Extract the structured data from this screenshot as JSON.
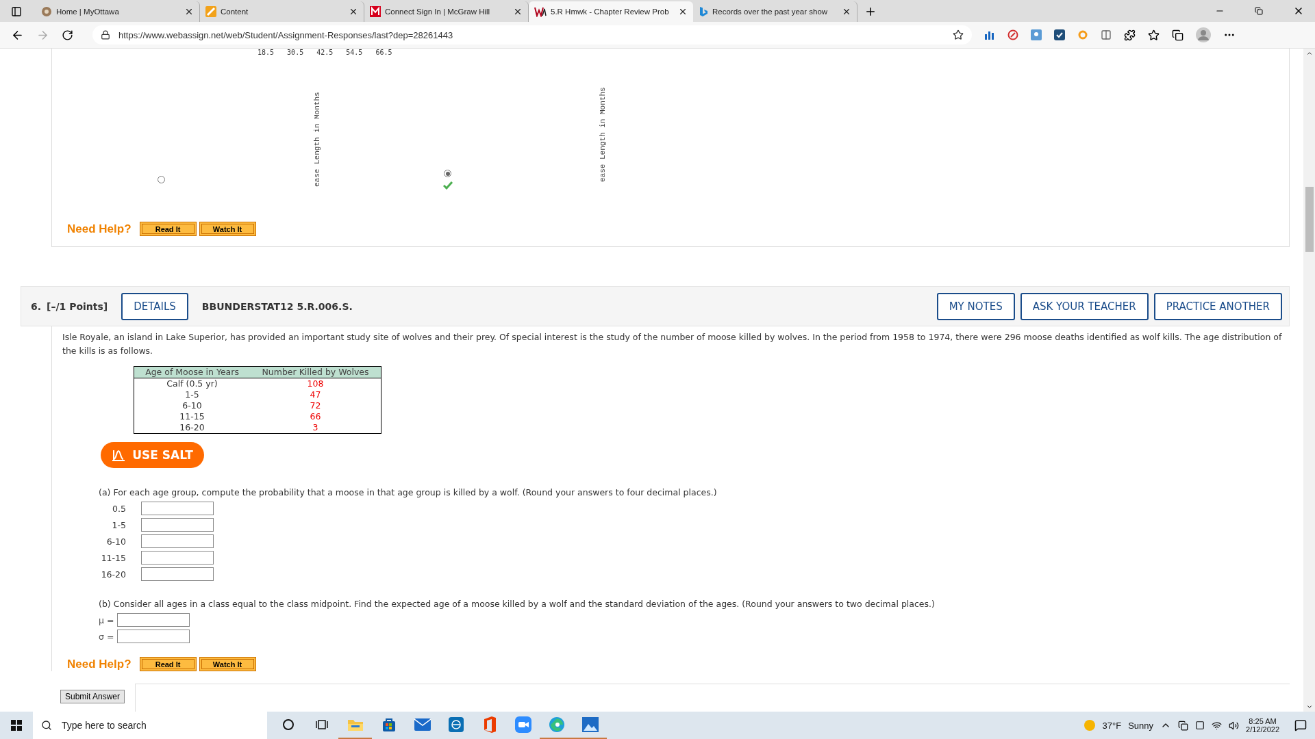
{
  "browser": {
    "tabs": [
      {
        "title": "Home | MyOttawa",
        "kind": "ottawa",
        "selected": false
      },
      {
        "title": "Content",
        "kind": "content",
        "selected": false
      },
      {
        "title": "Connect Sign In | McGraw Hill",
        "kind": "mcgraw",
        "selected": false
      },
      {
        "title": "5.R Hmwk - Chapter Review Prob",
        "kind": "webassign",
        "selected": true
      },
      {
        "title": "Records over the past year show",
        "kind": "bing",
        "selected": false
      }
    ],
    "address": "https://www.webassign.net/web/Student/Assignment-Responses/last?dep=28261443"
  },
  "previous_question": {
    "x_ticks": [
      "18.5",
      "30.5",
      "42.5",
      "54.5",
      "66.5"
    ],
    "axis_labels": [
      "ease Length in Months",
      "ease Length in Months"
    ],
    "options": [
      {
        "selected": false,
        "correct": false
      },
      {
        "selected": true,
        "correct": true
      }
    ],
    "help_label": "Need Help?",
    "help_buttons": [
      "Read It",
      "Watch It"
    ]
  },
  "question": {
    "number": "6.",
    "points": "[–/1 Points]",
    "details": "DETAILS",
    "code": "BBUNDERSTAT12 5.R.006.S.",
    "actions": [
      "MY NOTES",
      "ASK YOUR TEACHER",
      "PRACTICE ANOTHER"
    ],
    "intro": "Isle Royale, an island in Lake Superior, has provided an important study site of wolves and their prey. Of special interest is the study of the number of moose killed by wolves. In the period from 1958 to 1974, there were 296 moose deaths identified as wolf kills. The age distribution of the kills is as follows.",
    "table": {
      "columns": [
        "Age of Moose in Years",
        "Number Killed by Wolves"
      ],
      "rows": [
        [
          "Calf (0.5 yr)",
          "108"
        ],
        [
          "1-5",
          "47"
        ],
        [
          "6-10",
          "72"
        ],
        [
          "11-15",
          "66"
        ],
        [
          "16-20",
          "3"
        ]
      ]
    },
    "salt": "USE SALT",
    "part_a": {
      "prompt": "(a) For each age group, compute the probability that a moose in that age group is killed by a wolf. (Round your answers to four decimal places.)",
      "rows": [
        "0.5",
        "1-5",
        "6-10",
        "11-15",
        "16-20"
      ]
    },
    "part_b": {
      "prompt": "(b) Consider all ages in a class equal to the class midpoint. Find the expected age of a moose killed by a wolf and the standard deviation of the ages. (Round your answers to two decimal places.)",
      "fields": [
        "μ =",
        "σ ="
      ]
    },
    "help_label": "Need Help?",
    "help_buttons": [
      "Read It",
      "Watch It"
    ],
    "submit": "Submit Answer"
  },
  "taskbar": {
    "search_placeholder": "Type here to search",
    "apps": [
      {
        "kind": "cortana",
        "open": false
      },
      {
        "kind": "taskview",
        "open": false
      },
      {
        "kind": "explorer",
        "open": true
      },
      {
        "kind": "store",
        "open": false
      },
      {
        "kind": "mail",
        "open": false
      },
      {
        "kind": "dell",
        "open": false
      },
      {
        "kind": "office",
        "open": false
      },
      {
        "kind": "zoom",
        "open": false
      },
      {
        "kind": "edge",
        "open": true
      },
      {
        "kind": "photos",
        "open": true
      }
    ],
    "temperature": "37°F",
    "weather": "Sunny",
    "time": "8:25 AM",
    "date": "2/12/2022"
  }
}
